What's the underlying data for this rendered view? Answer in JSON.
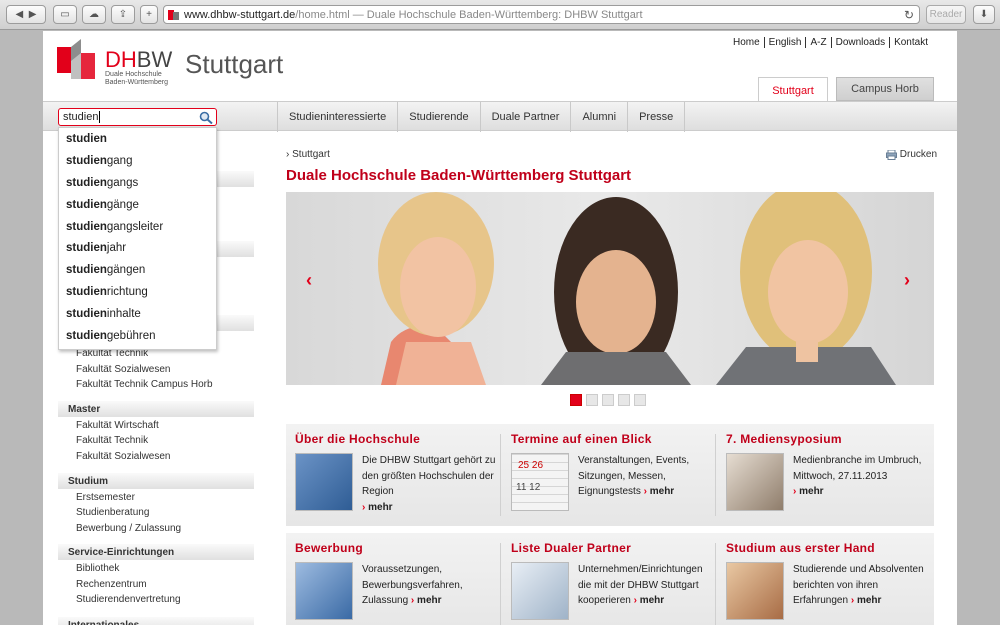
{
  "browser": {
    "url_domain": "www.dhbw-stuttgart.de",
    "url_path": "/home.html — Duale Hochschule Baden-Württemberg: DHBW Stuttgart",
    "reader_label": "Reader"
  },
  "header": {
    "logo_dh": "DH",
    "logo_bw": "BW",
    "logo_sub1": "Duale Hochschule",
    "logo_sub2": "Baden-Württemberg",
    "city": "Stuttgart",
    "toplinks": [
      "Home",
      "English",
      "A-Z",
      "Downloads",
      "Kontakt"
    ],
    "tab_active": "Stuttgart",
    "tab_other": "Campus Horb"
  },
  "nav": {
    "items": [
      "Studieninteressierte",
      "Studierende",
      "Duale Partner",
      "Alumni",
      "Presse"
    ]
  },
  "search": {
    "value": "studien",
    "suggestions": [
      {
        "bold": "studien",
        "rest": ""
      },
      {
        "bold": "studien",
        "rest": "gang"
      },
      {
        "bold": "studien",
        "rest": "gangs"
      },
      {
        "bold": "studien",
        "rest": "gänge"
      },
      {
        "bold": "studien",
        "rest": "gangsleiter"
      },
      {
        "bold": "studien",
        "rest": "jahr"
      },
      {
        "bold": "studien",
        "rest": "gängen"
      },
      {
        "bold": "studien",
        "rest": "richtung"
      },
      {
        "bold": "studien",
        "rest": "inhalte"
      },
      {
        "bold": "studien",
        "rest": "gebühren"
      }
    ]
  },
  "sidebar": {
    "partial_items": [
      "Fakultät Technik",
      "Fakultät Sozialwesen",
      "Fakultät Technik Campus Horb"
    ],
    "sections": [
      {
        "title": "Master",
        "items": [
          "Fakultät Wirtschaft",
          "Fakultät Technik",
          "Fakultät Sozialwesen"
        ]
      },
      {
        "title": "Studium",
        "items": [
          "Erstsemester",
          "Studienberatung",
          "Bewerbung / Zulassung"
        ]
      },
      {
        "title": "Service-Einrichtungen",
        "items": [
          "Bibliothek",
          "Rechenzentrum",
          "Studierendenvertretung"
        ]
      },
      {
        "title": "Internationales",
        "items": []
      }
    ]
  },
  "main": {
    "breadcrumb": "Stuttgart",
    "print_label": "Drucken",
    "title": "Duale Hochschule Baden-Württemberg Stuttgart",
    "slides_count": 5,
    "active_slide": 1,
    "more_label": "mehr",
    "teasers": [
      {
        "title": "Über die Hochschule",
        "text": "Die DHBW Stuttgart gehört zu den größten Hochschulen der Region",
        "img_color": "#3d6fae"
      },
      {
        "title": "Termine auf einen Blick",
        "text": "Veranstaltungen, Events, Sitzungen, Messen, Eignungstests",
        "img_color": "#cfcfcf"
      },
      {
        "title": "7. Mediensyposium",
        "text": "Medienbranche im Umbruch, Mittwoch, 27.11.2013",
        "img_color": "#b9a897"
      },
      {
        "title": "Bewerbung",
        "text": "Voraussetzungen, Bewerbungsverfahren, Zulassung",
        "img_color": "#4f82b8"
      },
      {
        "title": "Liste Dualer Partner",
        "text": "Unternehmen/Einrichtungen die mit der DHBW Stuttgart kooperieren",
        "img_color": "#c7d3df"
      },
      {
        "title": "Studium aus erster Hand",
        "text": "Studierende und Absolventen berichten von ihren Erfahrungen",
        "img_color": "#c9a27c"
      }
    ]
  },
  "colors": {
    "accent": "#e2001a",
    "title_red": "#c0001a"
  }
}
